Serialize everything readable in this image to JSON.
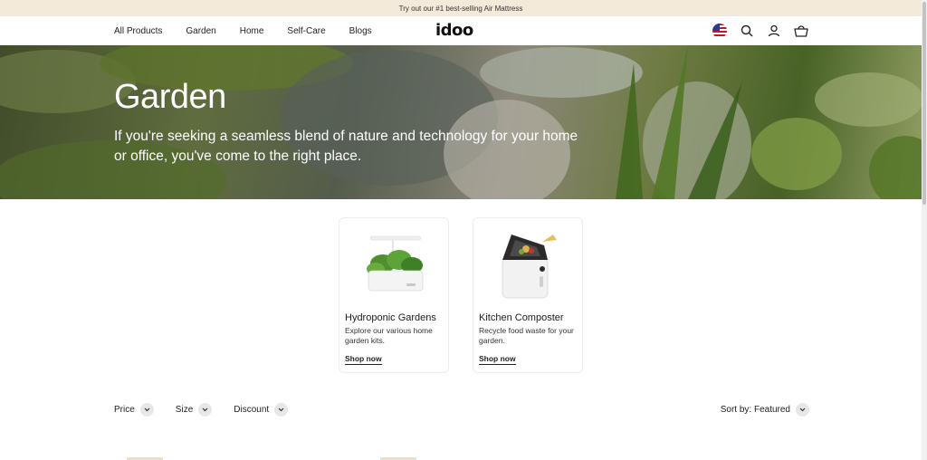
{
  "announcement": {
    "text": "Try out our #1 best-selling Air Mattress"
  },
  "nav": {
    "links": [
      "All Products",
      "Garden",
      "Home",
      "Self-Care",
      "Blogs"
    ],
    "logo": "idoo",
    "icons": [
      "us-flag-icon",
      "search-icon",
      "account-icon",
      "cart-icon"
    ]
  },
  "hero": {
    "title": "Garden",
    "subtitle": "If you're seeking a seamless blend of nature and technology for your home or office, you've come to the right place."
  },
  "collections": [
    {
      "title": "Hydroponic Gardens",
      "description": "Explore our various home garden kits.",
      "link": "Shop now",
      "image": "hydroponic-garden-image"
    },
    {
      "title": "Kitchen Composter",
      "description": "Recycle food waste for your garden.",
      "link": "Shop now",
      "image": "kitchen-composter-image"
    }
  ],
  "filters": {
    "items": [
      "Price",
      "Size",
      "Discount"
    ],
    "sort_label": "Sort by: Featured"
  },
  "colors": {
    "announcement_bg": "#f3ead9",
    "text": "#1c1c1c",
    "chip_bg": "#e7e7e7"
  }
}
